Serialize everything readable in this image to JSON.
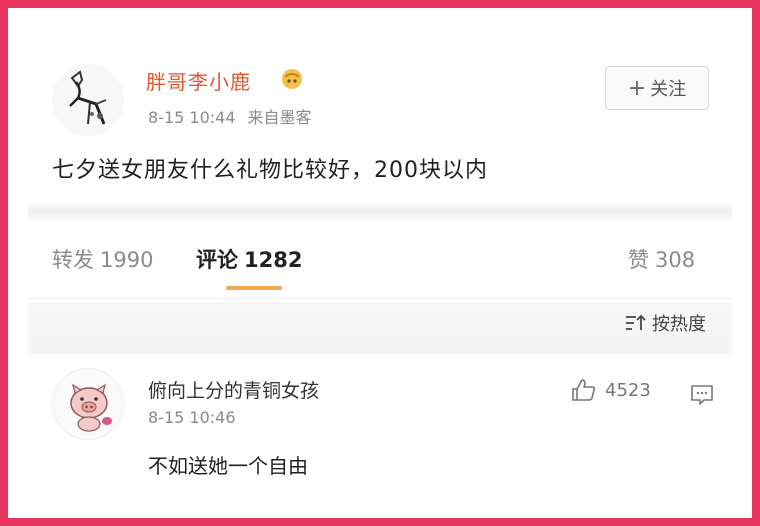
{
  "post": {
    "username": "胖哥李小鹿",
    "time": "8-15 10:44",
    "source": "来自墨客",
    "follow_label": "关注",
    "follow_plus": "+",
    "text": "七夕送女朋友什么礼物比较好，200块以内"
  },
  "stats": {
    "repost_label": "转发",
    "repost_count": "1990",
    "comment_label": "评论",
    "comment_count": "1282",
    "like_label": "赞",
    "like_count": "308"
  },
  "sort": {
    "label": "按热度"
  },
  "comment": {
    "username": "俯向上分的青铜女孩",
    "time": "8-15 10:46",
    "like_count": "4523",
    "text": "不如送她一个自由"
  },
  "colors": {
    "frame": "#e8335f",
    "username": "#e8562b",
    "tab_underline": "#f2a74b",
    "muted_text": "#8a8a8a"
  },
  "icons": [
    "avatar-deer",
    "vip-badge-icon",
    "sort-icon",
    "thumbs-up-icon",
    "reply-icon",
    "avatar-pig"
  ]
}
